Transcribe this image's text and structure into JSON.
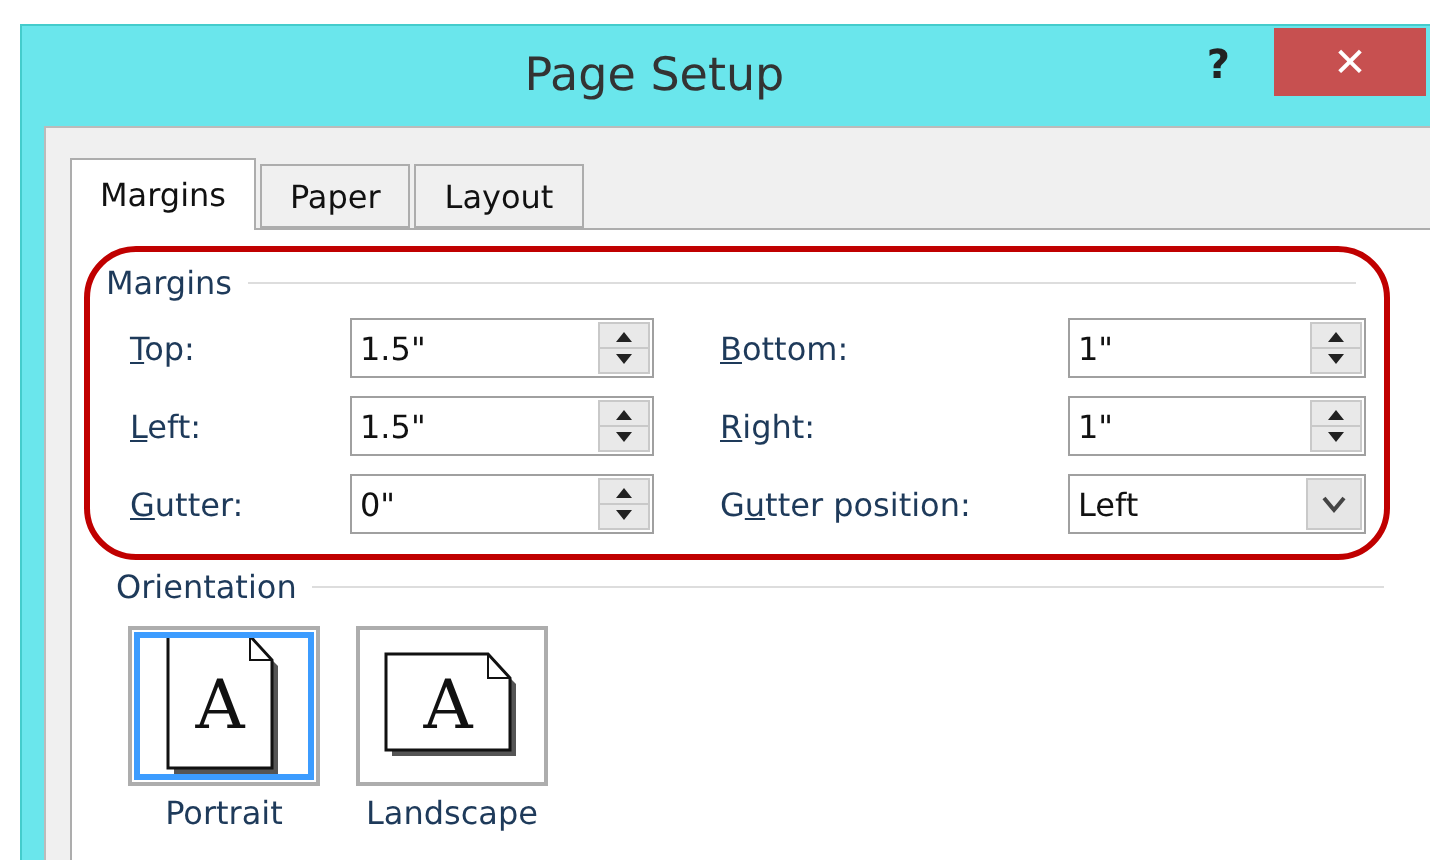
{
  "window": {
    "title": "Page Setup",
    "help": "?",
    "close": "✕"
  },
  "tabs": [
    {
      "label": "Margins",
      "selected": true
    },
    {
      "label": "Paper",
      "selected": false
    },
    {
      "label": "Layout",
      "selected": false
    }
  ],
  "margins": {
    "title": "Margins",
    "highlighted": true,
    "fields": [
      {
        "kind": "spin",
        "key": "T",
        "after": "op:",
        "value": "1.5\""
      },
      {
        "kind": "spin",
        "key": "B",
        "after": "ottom:",
        "value": "1\""
      },
      {
        "kind": "spin",
        "key": "L",
        "after": "eft:",
        "value": "1.5\""
      },
      {
        "kind": "spin",
        "key": "R",
        "after": "ight:",
        "value": "1\""
      },
      {
        "kind": "spin",
        "key": "G",
        "after": "utter:",
        "value": "0\""
      },
      {
        "kind": "dropdown",
        "before": "G",
        "key": "u",
        "after": "tter position:",
        "value": "Left"
      }
    ]
  },
  "orientation": {
    "title": "Orientation",
    "options": [
      {
        "label": "Portrait",
        "glyph": "A",
        "kind": "portrait",
        "selected": true
      },
      {
        "label": "Landscape",
        "glyph": "A",
        "kind": "landscape",
        "selected": false
      }
    ]
  }
}
